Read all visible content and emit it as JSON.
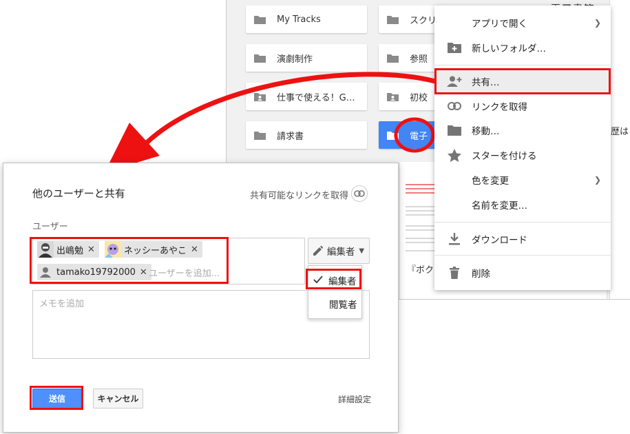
{
  "drive": {
    "folders_left": [
      "My Tracks",
      "演劇制作",
      "仕事で使える！G…",
      "請求書"
    ],
    "folders_mid": [
      "スクリ",
      "参照",
      "初校",
      "電子"
    ],
    "top_right_text": "電子書籍",
    "right_edge_text": "歴は",
    "preview_caption": "『ボクは"
  },
  "context_menu": {
    "items": [
      {
        "label": "アプリで開く",
        "icon": "",
        "submenu": true
      },
      {
        "label": "新しいフォルダ…",
        "icon": "new-folder-icon",
        "submenu": false
      },
      {
        "label": "共有…",
        "icon": "add-person-icon",
        "submenu": false
      },
      {
        "label": "リンクを取得",
        "icon": "link-icon",
        "submenu": false
      },
      {
        "label": "移動…",
        "icon": "folder-icon",
        "submenu": false
      },
      {
        "label": "スターを付ける",
        "icon": "star-icon",
        "submenu": false
      },
      {
        "label": "色を変更",
        "icon": "",
        "submenu": true
      },
      {
        "label": "名前を変更…",
        "icon": "",
        "submenu": false
      },
      {
        "label": "ダウンロード",
        "icon": "download-icon",
        "submenu": false
      },
      {
        "label": "削除",
        "icon": "trash-icon",
        "submenu": false
      }
    ]
  },
  "dialog": {
    "title": "他のユーザーと共有",
    "get_link": "共有可能なリンクを取得",
    "users_label": "ユーザー",
    "chips": [
      "出嶋勉",
      "ネッシーあやこ",
      "tamako19792000"
    ],
    "add_user_placeholder": "ユーザーを追加...",
    "permission": "編集者",
    "permission_options": [
      "編集者",
      "閲覧者"
    ],
    "memo_placeholder": "メモを追加",
    "send": "送信",
    "cancel": "キャンセル",
    "advanced": "詳細設定"
  },
  "colors": {
    "highlight": "#ee1111",
    "primary_button": "#4d90fe",
    "selected_folder": "#4285f4"
  }
}
